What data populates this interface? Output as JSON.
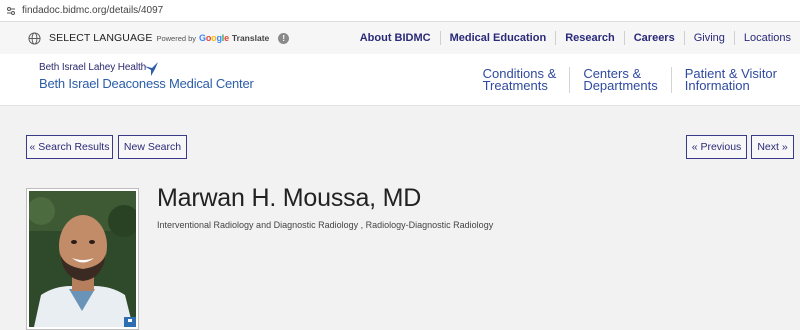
{
  "browser": {
    "url": "findadoc.bidmc.org/details/4097"
  },
  "utility_bar": {
    "language_label": "SELECT LANGUAGE",
    "powered_by": "Powered by",
    "google": "Google",
    "translate": "Translate",
    "info_glyph": "!",
    "links": [
      "About BIDMC",
      "Medical Education",
      "Research",
      "Careers",
      "Giving",
      "Locations"
    ]
  },
  "header": {
    "logo_top": "Beth Israel Lahey Health",
    "logo_bottom": "Beth Israel Deaconess Medical Center",
    "nav": [
      {
        "line1": "Conditions &",
        "line2": "Treatments"
      },
      {
        "line1": "Centers &",
        "line2": "Departments"
      },
      {
        "line1": "Patient & Visitor",
        "line2": "Information"
      }
    ]
  },
  "buttons": {
    "search_results": "« Search Results",
    "new_search": "New Search",
    "previous": "« Previous",
    "next": "Next »"
  },
  "profile": {
    "name": "Marwan H. Moussa, MD",
    "specialty": "Interventional Radiology and Diagnostic Radiology , Radiology-Diagnostic Radiology"
  },
  "colors": {
    "brand_navy": "#2b2a7a",
    "nav_blue": "#2f4aa0",
    "logo_blue": "#2b5da8",
    "page_bg": "#f2f2f2"
  }
}
